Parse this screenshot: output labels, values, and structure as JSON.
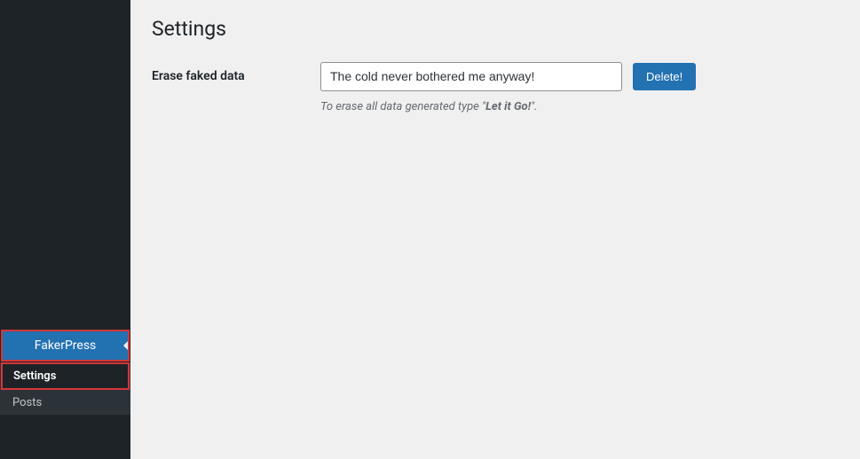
{
  "sidebar": {
    "parent_label": "FakerPress",
    "submenu": [
      {
        "label": "Settings",
        "current": true
      },
      {
        "label": "Posts",
        "current": false
      }
    ]
  },
  "page": {
    "title": "Settings"
  },
  "form": {
    "erase_label": "Erase faked data",
    "erase_input_value": "The cold never bothered me anyway!",
    "delete_button_label": "Delete!",
    "hint_prefix": "To erase all data generated type \"",
    "hint_phrase": "Let it Go!",
    "hint_suffix": "\"."
  }
}
